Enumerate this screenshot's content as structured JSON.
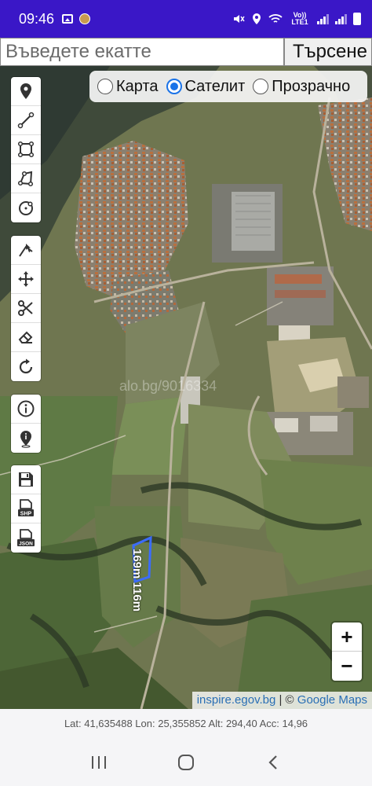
{
  "status_bar": {
    "time": "09:46",
    "network_label": "Vo)) LTE1",
    "icons": [
      "image-icon",
      "avatar-icon",
      "mute-icon",
      "location-icon",
      "wifi-icon",
      "signal-icon",
      "battery-icon"
    ]
  },
  "search": {
    "placeholder": "Въведете екатте",
    "value": "",
    "button_label": "Търсене"
  },
  "map_mode": {
    "options": [
      {
        "label": "Карта",
        "selected": false
      },
      {
        "label": "Сателит",
        "selected": true
      },
      {
        "label": "Прозрачно",
        "selected": false
      }
    ]
  },
  "tools": {
    "draw": [
      "marker-icon",
      "line-icon",
      "rectangle-icon",
      "polygon-icon",
      "circle-icon"
    ],
    "edit": [
      "snap-icon",
      "move-icon",
      "cut-icon",
      "eraser-icon",
      "rotate-icon"
    ],
    "info": [
      "info-icon",
      "location-info-icon"
    ],
    "export": [
      "save-icon",
      "shp-export-icon",
      "json-export-icon"
    ],
    "shp_label": "SHP",
    "json_label": "JSON"
  },
  "map": {
    "watermark": "alo.bg/9016334",
    "parcel_label": "169m 116m",
    "zoom_in": "+",
    "zoom_out": "−",
    "attribution_link1": "inspire.egov.bg",
    "attribution_sep": " | © ",
    "attribution_link2": "Google Maps"
  },
  "coordinates": "Lat: 41,635488 Lon: 25,355852 Alt: 294,40 Acc: 14,96",
  "colors": {
    "status_bar": "#3a17c7",
    "accent": "#1a73e8",
    "parcel": "#3b6cff"
  }
}
